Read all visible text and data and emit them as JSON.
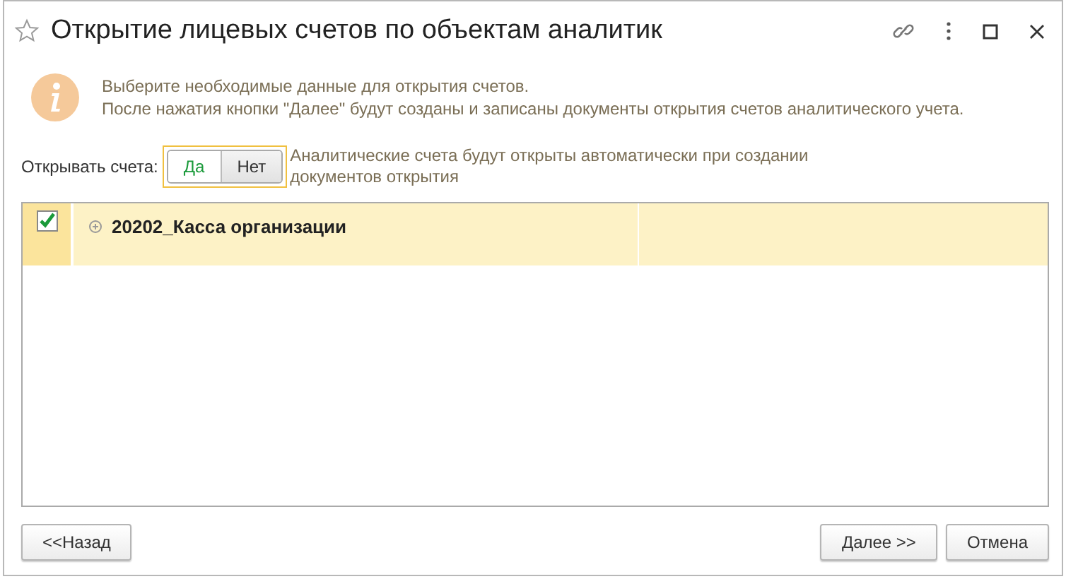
{
  "window": {
    "title": "Открытие лицевых счетов по объектам аналитик",
    "favorite": false
  },
  "info": {
    "lines": [
      "Выберите необходимые данные для открытия счетов.",
      "После нажатия кнопки \"Далее\" будут созданы и записаны документы открытия счетов аналитического учета."
    ]
  },
  "open_accounts": {
    "label": "Открывать счета:",
    "options": [
      {
        "label": "Да",
        "selected": true
      },
      {
        "label": "Нет",
        "selected": false
      }
    ],
    "hint": "Аналитические счета будут открыты автоматически при создании документов открытия"
  },
  "table": {
    "rows": [
      {
        "checked": true,
        "name": "20202_Касса организации",
        "expanded": false,
        "selected": true
      }
    ]
  },
  "buttons": {
    "back": "<<Назад",
    "next": "Далее >>",
    "cancel": "Отмена"
  }
}
